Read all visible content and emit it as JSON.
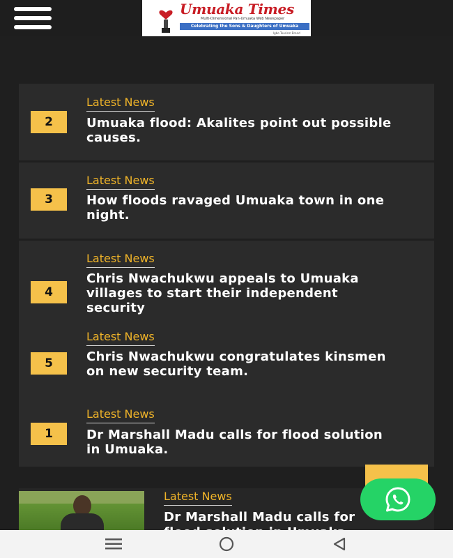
{
  "header": {
    "menu_icon": "hamburger-menu-icon",
    "logo": {
      "brand": "Umuaka Times",
      "small_text": "Multi-Dimensional Pan-Umuaka Web Newspaper",
      "tagline": "Celebrating the Sons & Daughters of Umuaka",
      "subtext": "Igbo Tourism Brand"
    }
  },
  "headlines": {
    "items": [
      {
        "rank": "2",
        "category": "Latest News",
        "title": "Umuaka flood: Akalites point out possible causes."
      },
      {
        "rank": "3",
        "category": "Latest News",
        "title": "How floods ravaged Umuaka town in one night."
      },
      {
        "rank": "4",
        "category": "Latest News",
        "title": "Chris Nwachukwu appeals to Umuaka villages to start their independent security"
      },
      {
        "rank": "5",
        "category": "Latest News",
        "title": "Chris Nwachukwu congratulates kinsmen on new security team."
      },
      {
        "rank": "1",
        "category": "Latest News",
        "title": "Dr Marshall Madu calls for flood solution in Umuaka."
      }
    ]
  },
  "feature": {
    "category": "Latest News",
    "title": "Dr Marshall Madu calls for flood solution in Umuaka."
  },
  "floating": {
    "whatsapp_icon": "whatsapp-icon"
  },
  "navbar": {
    "icons": [
      "recent-apps-icon",
      "home-icon",
      "back-icon"
    ]
  },
  "colors": {
    "background": "#1f1f1f",
    "card": "#2b2b2b",
    "accent_yellow": "#f5c14a",
    "category_text": "#f0b429",
    "whatsapp_green": "#25d366",
    "brand_red": "#c81d25",
    "tagline_blue": "#3b6fc4"
  }
}
